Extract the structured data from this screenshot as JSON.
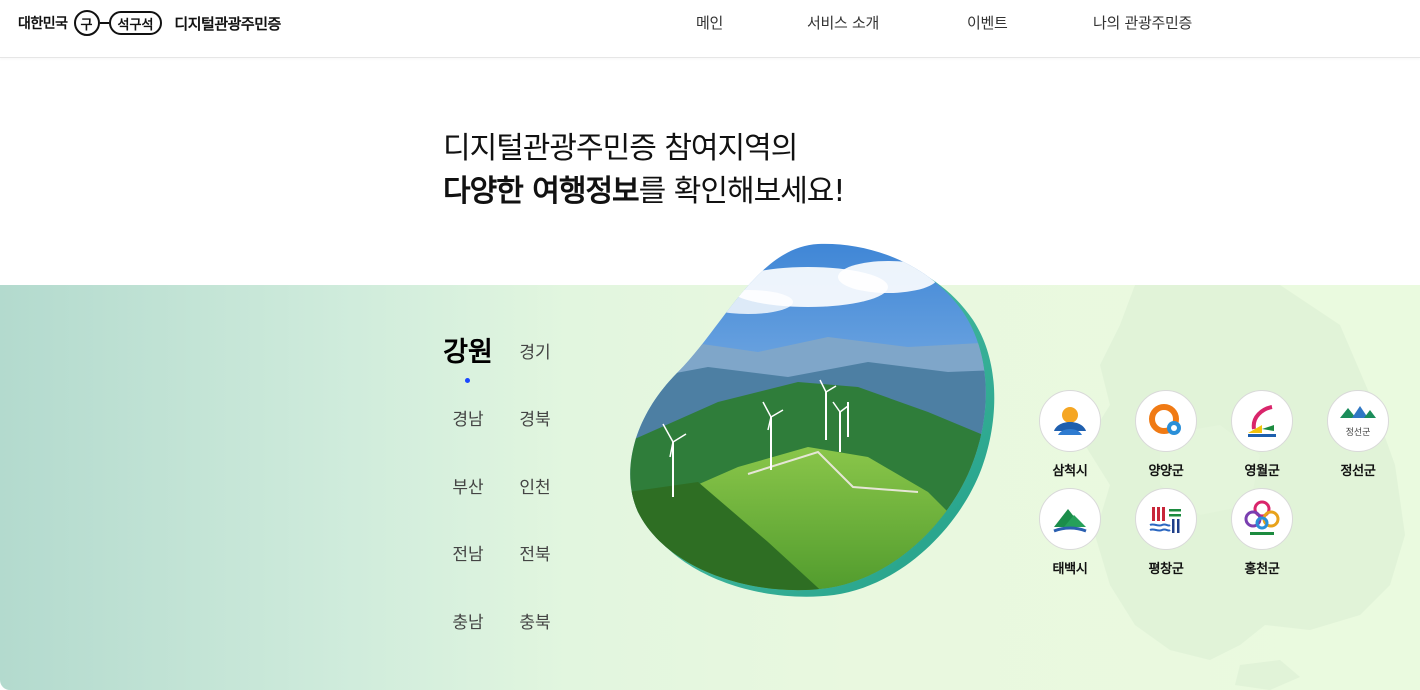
{
  "header": {
    "logo_small": "대한민국",
    "logo_gu": "구",
    "logo_seok": "석구석",
    "logo_title": "디지털관광주민증",
    "nav": [
      "메인",
      "서비스 소개",
      "이벤트",
      "나의 관광주민증"
    ]
  },
  "headline": {
    "line1": "디지털관광주민증 참여지역의",
    "line2_bold": "다양한 여행정보",
    "line2_rest": "를 확인해보세요!"
  },
  "regions": {
    "active": "강원",
    "items": [
      "경기",
      "경남",
      "경북",
      "부산",
      "인천",
      "전남",
      "전북",
      "충남",
      "충북"
    ]
  },
  "cities": [
    {
      "name": "삼척시",
      "icon": "samcheok-emblem-icon"
    },
    {
      "name": "양양군",
      "icon": "yangyang-emblem-icon"
    },
    {
      "name": "영월군",
      "icon": "yeongwol-emblem-icon"
    },
    {
      "name": "정선군",
      "icon": "jeongseon-emblem-icon",
      "emblem_text": "정선군"
    },
    {
      "name": "태백시",
      "icon": "taebaek-emblem-icon"
    },
    {
      "name": "평창군",
      "icon": "pyeongchang-emblem-icon"
    },
    {
      "name": "홍천군",
      "icon": "hongcheon-emblem-icon"
    }
  ],
  "colors": {
    "accent": "#1a48ff",
    "section_bg_left": "#b3dace",
    "section_bg_right": "#eafadf"
  }
}
